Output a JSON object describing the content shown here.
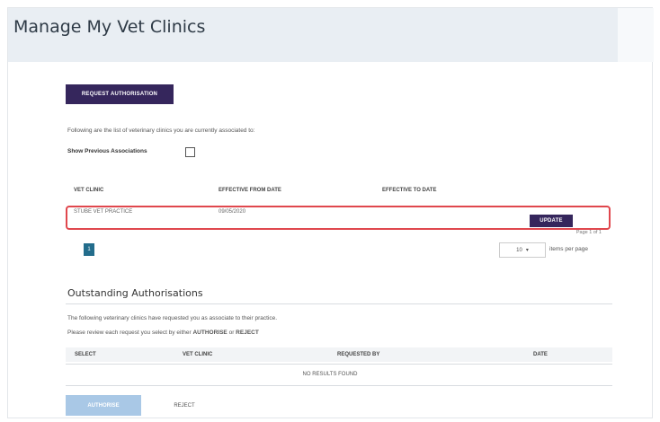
{
  "page": {
    "title": "Manage My Vet Clinics"
  },
  "actions": {
    "request_authorisation": "REQUEST AUTHORISATION"
  },
  "associated": {
    "intro": "Following are the list of veterinary clinics you are currently associated to:",
    "show_previous_label": "Show Previous Associations",
    "columns": [
      "VET CLINIC",
      "EFFECTIVE FROM DATE",
      "EFFECTIVE TO DATE"
    ],
    "rows": [
      {
        "clinic": "STUBE VET PRACTICE",
        "from": "09/05/2020",
        "to": "",
        "action": "UPDATE"
      }
    ],
    "pagination": {
      "current_page": "1",
      "page_info": "Page 1 of 1",
      "per_page": "10",
      "per_page_label": "items per page"
    }
  },
  "outstanding": {
    "title": "Outstanding Authorisations",
    "intro": "The following veterinary clinics have requested you as associate to their practice.",
    "instruction_prefix": "Please review each request you select by either",
    "instruction_approve": "AUTHORISE",
    "instruction_or": "or",
    "instruction_reject": "REJECT",
    "columns": [
      "SELECT",
      "VET CLINIC",
      "REQUESTED BY",
      "DATE"
    ],
    "empty_text": "NO RESULTS FOUND",
    "approve_label": "AUTHORISE",
    "reject_label": "REJECT"
  }
}
